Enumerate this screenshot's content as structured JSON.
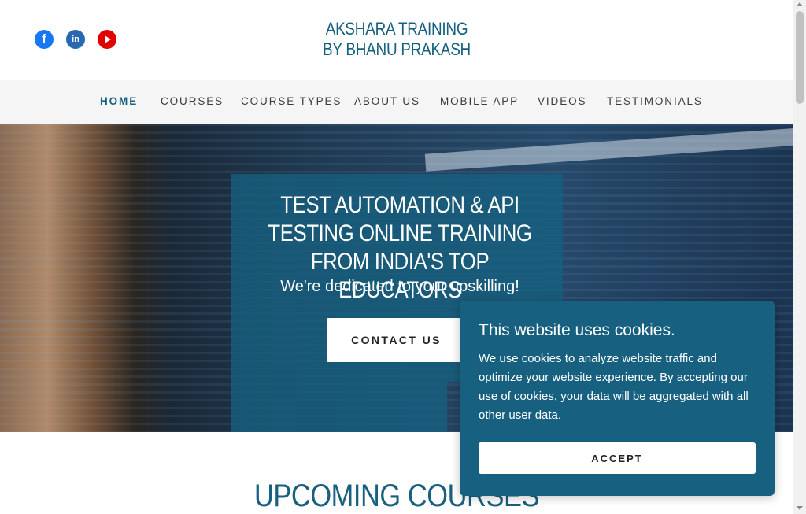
{
  "header": {
    "brand_line1": "AKSHARA TRAINING",
    "brand_line2": "BY BHANU PRAKASH",
    "social": [
      {
        "name": "facebook-icon",
        "glyph": "f",
        "color": "#1877f2"
      },
      {
        "name": "linkedin-icon",
        "glyph": "in",
        "color": "#2867b2"
      },
      {
        "name": "youtube-icon",
        "color": "#e00000"
      }
    ]
  },
  "nav": {
    "items": [
      "HOME",
      "COURSES",
      "COURSE TYPES",
      "ABOUT US",
      "MOBILE APP",
      "VIDEOS",
      "TESTIMONIALS"
    ],
    "active": "HOME"
  },
  "hero": {
    "title_line1": "TEST AUTOMATION & API",
    "title_line2": "TESTING ONLINE TRAINING",
    "title_line3": "FROM INDIA'S TOP EDUCATORS",
    "subtitle": "We're dedicated to your upskilling!",
    "cta_label": "CONTACT US"
  },
  "sections": {
    "upcoming_title": "UPCOMING COURSES"
  },
  "cookie_banner": {
    "title": "This website uses cookies.",
    "text": "We use cookies to analyze website traffic and optimize your website experience. By accepting our use of cookies, your data will be aggregated with all other user data.",
    "accept_label": "ACCEPT"
  },
  "colors": {
    "brand": "#17607f",
    "nav_bg": "#f5f5f5",
    "text": "#3a3a3a"
  }
}
